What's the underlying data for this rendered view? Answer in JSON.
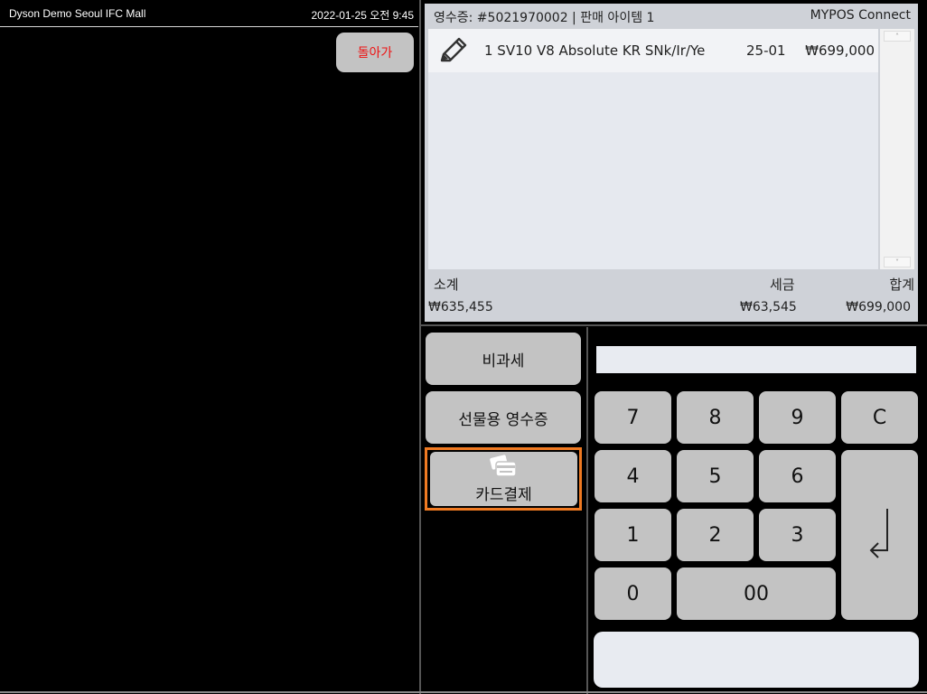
{
  "header": {
    "store_name": "Dyson Demo Seoul IFC Mall",
    "datetime": "2022-01-25 오전 9:45",
    "back_label": "돌아가"
  },
  "receipt": {
    "title": "영수증: #5021970002 | 판매 아이템 1",
    "brand": "MYPOS Connect",
    "items": [
      {
        "description": "1 SV10 V8 Absolute KR SNk/Ir/Ye",
        "code": "25-01",
        "price": "₩699,000"
      }
    ],
    "scroll_up": "˄",
    "scroll_down": "˅",
    "totals": {
      "subtotal_label": "소계",
      "tax_label": "세금",
      "total_label": "합계",
      "subtotal_value": "₩635,455",
      "tax_value": "₩63,545",
      "total_value": "₩699,000"
    }
  },
  "functions": {
    "tax_free": "비과세",
    "gift_receipt": "선물용 영수증",
    "card_payment": "카드결제"
  },
  "keypad": {
    "display_value": "",
    "k7": "7",
    "k8": "8",
    "k9": "9",
    "clear": "C",
    "k4": "4",
    "k5": "5",
    "k6": "6",
    "k1": "1",
    "k2": "2",
    "k3": "3",
    "k0": "0",
    "k00": "00",
    "enter": "↲"
  },
  "colors": {
    "highlight": "#f07a22",
    "back_text": "#ee1111",
    "button_bg": "#c3c3c3"
  },
  "icons": {
    "edit": "pencil-icon",
    "card": "credit-card-icon",
    "enter": "enter-arrow-icon"
  }
}
